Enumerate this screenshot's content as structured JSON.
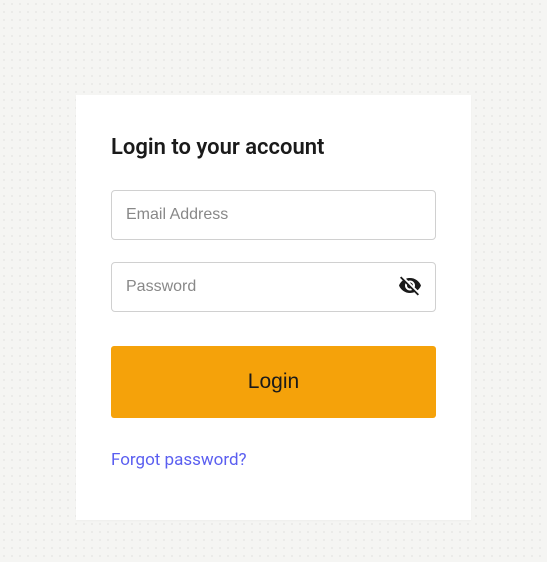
{
  "card": {
    "title": "Login to your account",
    "email": {
      "placeholder": "Email Address",
      "value": ""
    },
    "password": {
      "placeholder": "Password",
      "value": ""
    },
    "login_button": "Login",
    "forgot_link": "Forgot password?"
  }
}
